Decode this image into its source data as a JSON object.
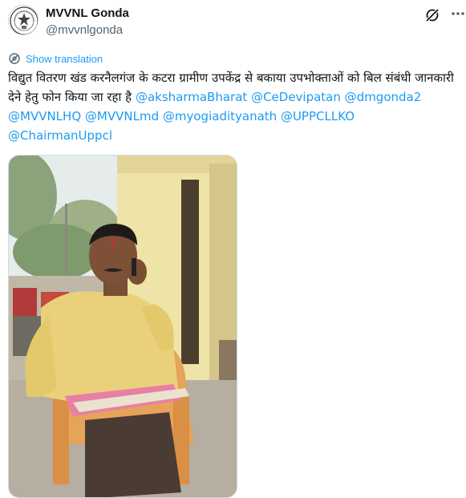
{
  "author": {
    "display_name": "MVVNL Gonda",
    "handle": "@mvvnlgonda",
    "avatar_icon": "mvvnl-logo-icon"
  },
  "header_actions": {
    "grok_icon": "grok-icon",
    "more_icon": "more-options-icon"
  },
  "translation": {
    "label": "Show translation",
    "icon": "translate-icon",
    "color": "#1d9bf0"
  },
  "tweet": {
    "text": "विद्युत वितरण खंड करनैलगंज के कटरा ग्रामीण उपकेंद्र से बकाया उपभोक्ताओं को बिल संबंधी जानकारी देने हेतु फोन किया जा रहा है",
    "mentions": [
      "@aksharmaBharat",
      "@CeDevipatan",
      "@dmgonda2",
      "@MVVNLHQ",
      "@MVVNLmd",
      "@myogiadityanath",
      "@UPPCLLKO",
      "@ChairmanUppcl"
    ],
    "mention_color": "#1d9bf0"
  },
  "media": {
    "type": "photo"
  }
}
